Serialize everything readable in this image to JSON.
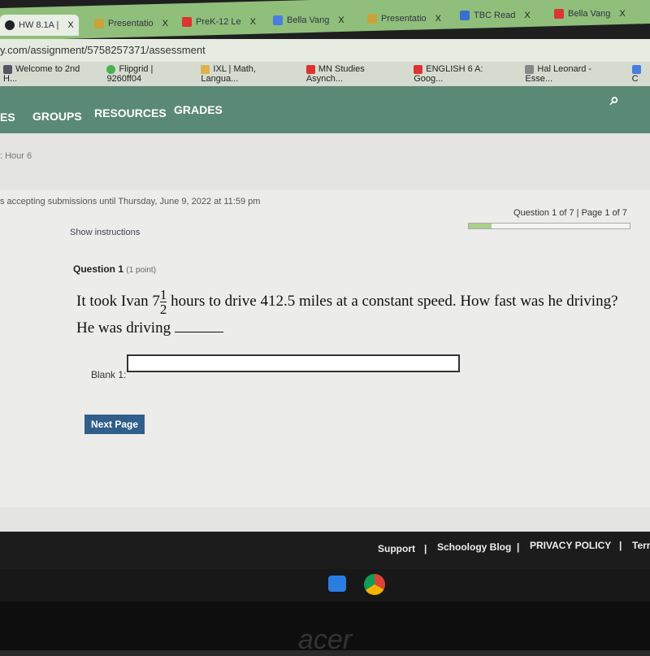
{
  "browser": {
    "tabs": [
      {
        "label": "HW 8.1A |",
        "color": "#222"
      },
      {
        "label": "Presentatio",
        "color": "#c9a23a"
      },
      {
        "label": "PreK-12 Le",
        "color": "#d33"
      },
      {
        "label": "Bella Vang",
        "color": "#4a7de0"
      },
      {
        "label": "Presentatio",
        "color": "#c9a23a"
      },
      {
        "label": "TBC Read",
        "color": "#3a6fd0"
      },
      {
        "label": "Bella Vang",
        "color": "#d33"
      }
    ],
    "close": "X",
    "address": "y.com/assignment/5758257371/assessment",
    "bookmarks": [
      {
        "label": "Welcome to 2nd H...",
        "color": "#556"
      },
      {
        "label": "Flipgrid | 9260ff04",
        "color": "#4caf50"
      },
      {
        "label": "IXL | Math, Langua...",
        "color": "#e0b04a"
      },
      {
        "label": "MN Studies Asynch...",
        "color": "#d33"
      },
      {
        "label": "ENGLISH 6 A: Goog...",
        "color": "#d33"
      },
      {
        "label": "Hal Leonard - Esse...",
        "color": "#888"
      },
      {
        "label": "C",
        "color": "#4a7de0"
      }
    ]
  },
  "nav": {
    "items": [
      "ES",
      "GROUPS",
      "RESOURCES",
      "GRADES"
    ],
    "search_icon": "search-icon"
  },
  "breadcrumb": ": Hour 6",
  "assessment": {
    "due": "s accepting submissions until Thursday, June 9, 2022 at 11:59 pm",
    "question_of": "Question 1 of 7 | Page 1 of 7",
    "progress_fraction": 0.143,
    "show_instructions": "Show instructions",
    "question_title": "Question 1",
    "question_points": "(1 point)",
    "text_before": "It took Ivan ",
    "whole": "7",
    "num": "1",
    "den": "2",
    "text_after": " hours to drive 412.5 miles at a constant speed. How fast was he driving? He was driving ",
    "blank_label": "Blank 1:",
    "blank_value": "",
    "next_label": "Next Page"
  },
  "footer": {
    "links": [
      "Support",
      "|",
      "Schoology Blog",
      "|",
      "PRIVACY POLICY",
      "|",
      "Terr"
    ]
  },
  "bezel_logo": "acer"
}
